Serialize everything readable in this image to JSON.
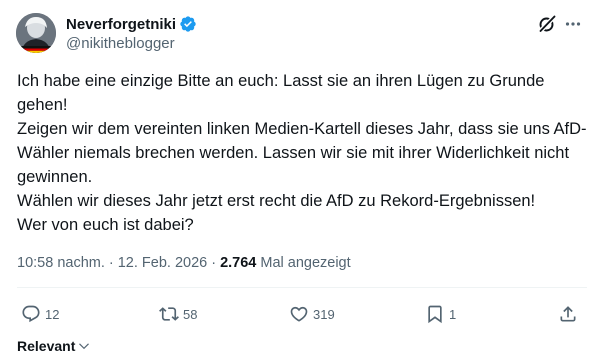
{
  "author": {
    "display_name": "Neverforgetniki",
    "handle": "@nikitheblogger",
    "verified": true
  },
  "tweet": {
    "text": "Ich habe eine einzige Bitte an euch: Lasst sie an ihren Lügen zu Grunde gehen!\nZeigen wir dem vereinten linken Medien-Kartell dieses Jahr, dass sie uns AfD-Wähler niemals brechen werden. Lassen wir sie mit ihrer Widerlichkeit nicht gewinnen.\nWählen wir dieses Jahr jetzt erst recht die AfD zu Rekord-Ergebnissen!\nWer von euch ist dabei?"
  },
  "meta": {
    "time": "10:58 nachm.",
    "separator": "·",
    "date": "12. Feb. 2026",
    "views_count": "2.764",
    "views_label": "Mal angezeigt"
  },
  "actions": {
    "replies": "12",
    "reposts": "58",
    "likes": "319",
    "bookmarks": "1"
  },
  "sort": {
    "label": "Relevant"
  },
  "icons": {
    "verified": "verified-badge-icon",
    "grok": "grok-icon",
    "more": "more-icon",
    "reply": "reply-icon",
    "repost": "repost-icon",
    "like": "like-icon",
    "bookmark": "bookmark-icon",
    "share": "share-icon",
    "chevron": "chevron-down-icon"
  },
  "colors": {
    "verified_blue": "#1d9bf0",
    "text_primary": "#0f1419",
    "text_secondary": "#536471",
    "divider": "#eff3f4"
  }
}
